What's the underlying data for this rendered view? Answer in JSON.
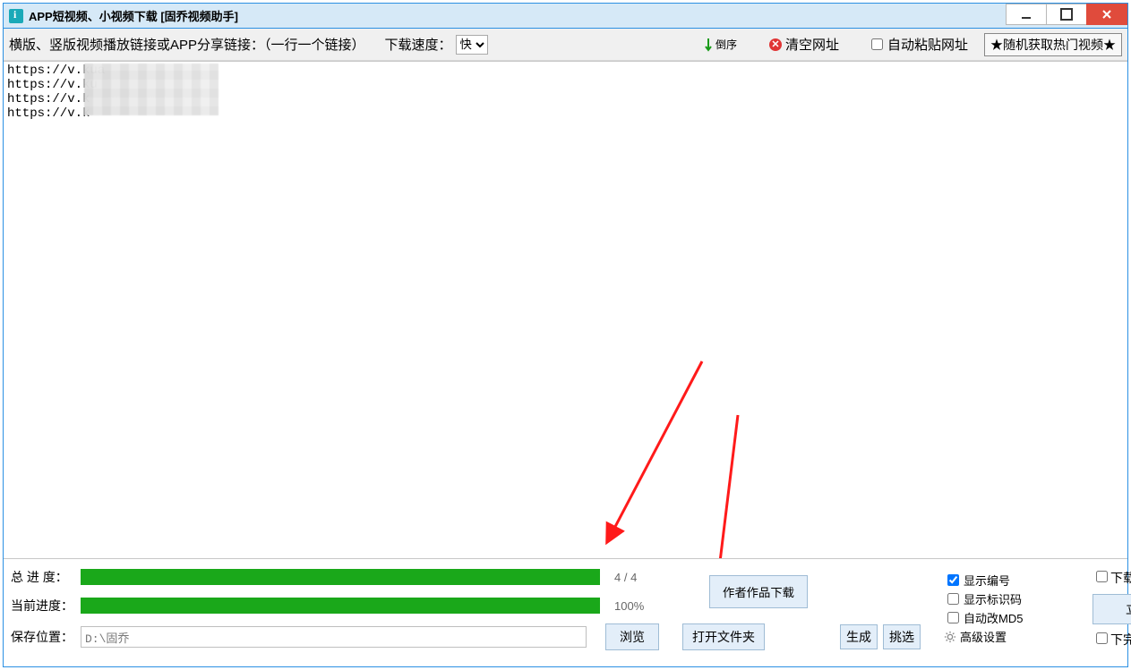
{
  "title": "APP短视频、小视频下载 [固乔视频助手]",
  "toolbar": {
    "prompt": "横版、竖版视频播放链接或APP分享链接：（一行一个链接）",
    "speed_label": "下载速度：",
    "speed_selected": "快",
    "reverse_label": "倒序",
    "clear_label": "清空网址",
    "autopaste_label": "自动粘贴网址",
    "hot_button": "★随机获取热门视频★"
  },
  "urls": "https://v.kua\nhttps://v.ku\nhttps://v.k\nhttps://v.k",
  "progress": {
    "total_label": "总 进 度：",
    "total_ratio": "4 / 4",
    "total_pct": 100,
    "current_label": "当前进度：",
    "current_text": "100%",
    "current_pct": 100
  },
  "actions": {
    "author_download": "作者作品下载",
    "browse": "浏览",
    "open_folder": "打开文件夹",
    "generate": "生成",
    "select": "挑选",
    "download_now": "立即下载"
  },
  "options": {
    "show_index": "显示编号",
    "show_mark": "显示标识码",
    "auto_md5": "自动改MD5",
    "advanced": "高级设置",
    "auto_shutdown": "下载完成自动关机",
    "finish_sound": "下完提示音"
  },
  "save": {
    "label": "保存位置：",
    "path": "D:\\固乔"
  },
  "checks": {
    "show_index": true,
    "show_mark": false,
    "auto_md5": false,
    "autopaste": false,
    "auto_shutdown": false,
    "finish_sound": false
  }
}
